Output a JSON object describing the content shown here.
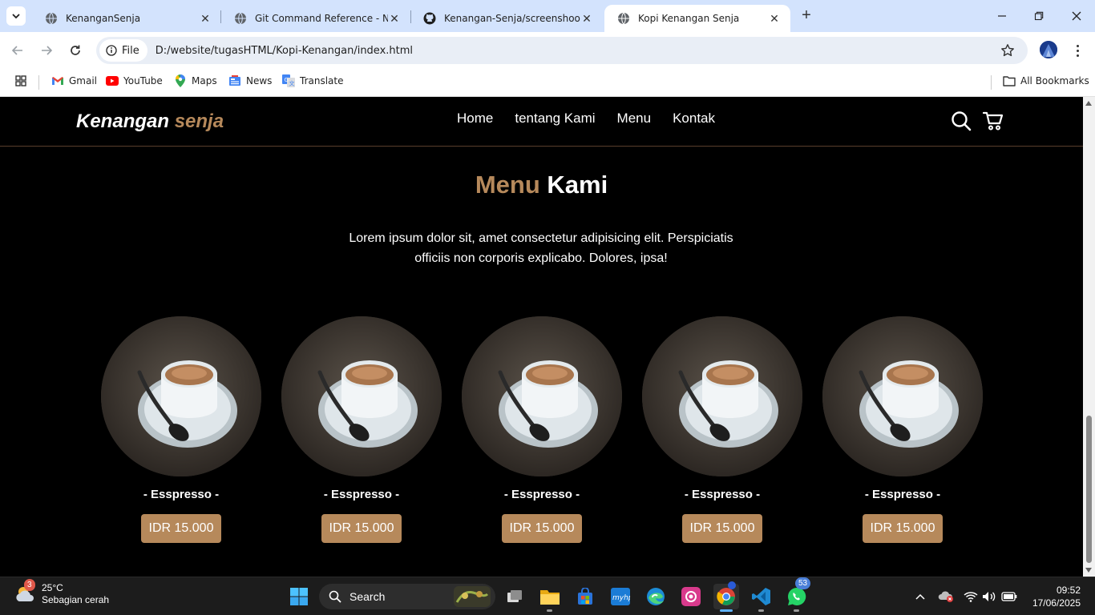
{
  "browser": {
    "tabs": [
      {
        "title": "KenanganSenja",
        "active": false
      },
      {
        "title": "Git Command Reference - Now",
        "active": false
      },
      {
        "title": "Kenangan-Senja/screenshoot/h",
        "active": false
      },
      {
        "title": "Kopi Kenangan Senja",
        "active": true
      }
    ],
    "new_tab_label": "+",
    "omnibox": {
      "chip_label": "File",
      "url": "D:/website/tugasHTML/Kopi-Kenangan/index.html"
    },
    "bookmarks": [
      {
        "label": "Gmail",
        "icon": "gmail-icon"
      },
      {
        "label": "YouTube",
        "icon": "youtube-icon"
      },
      {
        "label": "Maps",
        "icon": "maps-icon"
      },
      {
        "label": "News",
        "icon": "news-icon"
      },
      {
        "label": "Translate",
        "icon": "translate-icon"
      }
    ],
    "all_bookmarks_label": "All Bookmarks"
  },
  "site": {
    "logo_part1": "Kenangan",
    "logo_part2": "senja",
    "nav": [
      "Home",
      "tentang Kami",
      "Menu",
      "Kontak"
    ],
    "section_title_part1": "Menu",
    "section_title_part2": "Kami",
    "section_desc": "Lorem ipsum dolor sit, amet consectetur adipisicing elit. Perspiciatis officiis non corporis explicabo. Dolores, ipsa!",
    "menu_items": [
      {
        "name": "- Esspresso -",
        "price": "IDR 15.000"
      },
      {
        "name": "- Esspresso -",
        "price": "IDR 15.000"
      },
      {
        "name": "- Esspresso -",
        "price": "IDR 15.000"
      },
      {
        "name": "- Esspresso -",
        "price": "IDR 15.000"
      },
      {
        "name": "- Esspresso -",
        "price": "IDR 15.000"
      }
    ],
    "accent_color": "#b6895b"
  },
  "taskbar": {
    "weather_temp": "25°C",
    "weather_desc": "Sebagian cerah",
    "weather_badge": "3",
    "search_label": "Search",
    "whatsapp_badge": "53",
    "time": "09:52",
    "date": "17/06/2025"
  }
}
